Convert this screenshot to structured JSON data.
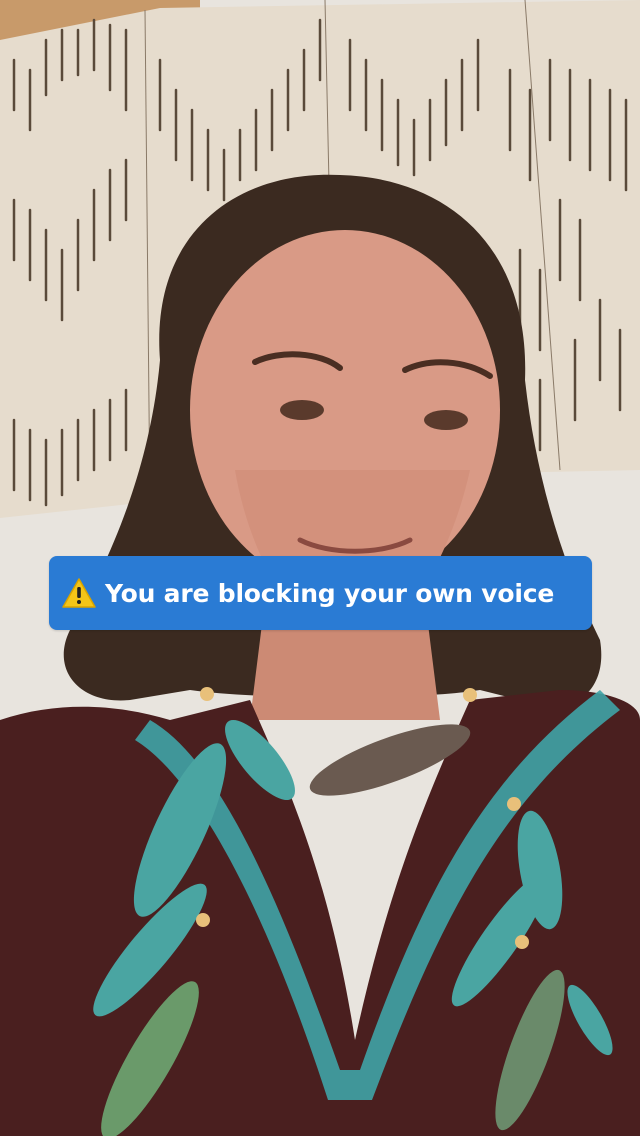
{
  "caption": {
    "icon": "warning-icon",
    "text": "You are blocking your own voice",
    "background_color": "#2a7bd4",
    "text_color": "#ffffff"
  },
  "scene": {
    "subject": "person-with-feather-necklace",
    "backdrop": "woven-wall-hanging"
  }
}
